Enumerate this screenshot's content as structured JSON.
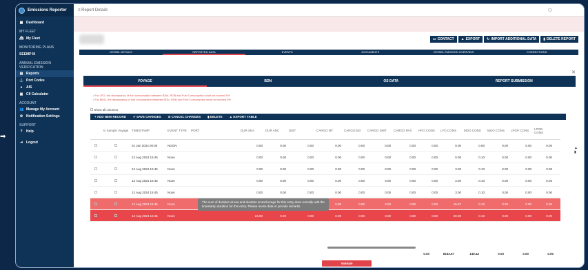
{
  "app": {
    "title": "Emissions Reporter"
  },
  "sidebar": {
    "dashboard": "Dashboard",
    "my_fleet_head": "MY FLEET",
    "my_fleet": "My Fleet",
    "monitoring_head": "MONITORING PLANS",
    "monitoring_item": "SEEMP III",
    "annual_head_1": "ANNUAL EMISSION",
    "annual_head_2": "VERIFICATION",
    "reports": "Reports",
    "port_codes": "Port Codes",
    "ais": "AIS",
    "cii_calculator": "CII Calculator",
    "account_head": "ACCOUNT",
    "manage_account": "Manage My Account",
    "notification_settings": "Notification Settings",
    "support_head": "SUPPORT",
    "help": "Help",
    "logout": "Logout"
  },
  "topbar": {
    "breadcrumb": "Report Details"
  },
  "actions": {
    "contact": "CONTACT",
    "export": "EXPORT",
    "import": "IMPORT ADDITIONAL DATA",
    "delete": "DELETE REPORT"
  },
  "tabs1": [
    "VESSEL DETAILS",
    "REPORTED DATA",
    "EVENTS",
    "DOCUMENTS",
    "VESSEL EMISSION OVERVIEW",
    "CORRECTIONS"
  ],
  "tabs2": [
    "VOYAGE",
    "BDN",
    "OS DATA",
    "REPORT SUBMISSION"
  ],
  "notes": [
    "• For LFO, the discrepancy of fuel consumption between BDN, ROB and Fuel Consumption shall not exceed 5%",
    "• For MDO, the discrepancy of fuel consumption between BDN, ROB and Fuel Consumption shall not exceed 5%"
  ],
  "show_all_columns": "Show all columns",
  "toolbar": {
    "add": "+ ADD NEW RECORD",
    "save": "SAVE CHANGES",
    "cancel": "CANCEL CHANGES",
    "delete": "DELETE",
    "export": "EXPORT TABLE"
  },
  "table": {
    "headers": [
      "Is Sample Voyage",
      "TIMESTAMP",
      "EVENT TYPE",
      "PORT",
      "DUR SEA",
      "DUR ANC",
      "DIST",
      "CARGO MT",
      "CARGO M3",
      "CARGO DWT",
      "CARGO PAX",
      "HFO CONS",
      "LFO CONS",
      "MDO CONS",
      "MGO CONS",
      "LPGP CONS",
      "LPGB CONS"
    ],
    "rows": [
      {
        "ts": "01 Jan 2024 00:00",
        "event": "NOON",
        "sea": "0.00",
        "anc": "0.00",
        "dist": "0.00",
        "v": [
          "0.00",
          "0.00",
          "0.00",
          "0.00",
          "0.00",
          "0.00",
          "0.00",
          "0.00",
          "0.00",
          "0.00"
        ]
      },
      {
        "ts": "12 Aug 2024 15:45",
        "event": "Noon",
        "sea": "0.00",
        "anc": "0.00",
        "dist": "0.00",
        "v": [
          "0.00",
          "0.00",
          "0.00",
          "0.00",
          "0.00",
          "0.00",
          "0.10",
          "0.00",
          "0.00",
          "0.00"
        ]
      },
      {
        "ts": "12 Aug 2024 15:45",
        "event": "Noon",
        "sea": "0.00",
        "anc": "0.00",
        "dist": "0.00",
        "v": [
          "0.00",
          "0.00",
          "0.00",
          "0.00",
          "0.00",
          "3.00",
          "0.10",
          "0.00",
          "0.00",
          "0.00"
        ]
      },
      {
        "ts": "12 Aug 2024 15:45",
        "event": "Noon",
        "sea": "0.00",
        "anc": "0.00",
        "dist": "0.00",
        "v": [
          "0.00",
          "0.00",
          "0.00",
          "0.00",
          "0.00",
          "3.00",
          "0.10",
          "0.00",
          "0.00",
          "0.00"
        ]
      },
      {
        "ts": "12 Aug 2024 15:45",
        "event": "Noon",
        "sea": "0.00",
        "anc": "0.00",
        "dist": "0.00",
        "v": [
          "0.00",
          "0.00",
          "0.00",
          "0.00",
          "0.00",
          "3.00",
          "0.10",
          "0.00",
          "0.00",
          "0.00"
        ]
      },
      {
        "ts": "12 Aug 2024 15:45",
        "event": "Noon",
        "sea": "18.00",
        "anc": "0.00",
        "dist": "0.00",
        "v": [
          "0.00",
          "0.00",
          "0.00",
          "0.00",
          "0.00",
          "15.87",
          "0.10",
          "0.00",
          "0.00",
          "0.00"
        ]
      },
      {
        "ts": "12 Aug 2024 15:45",
        "event": "Noon",
        "sea": "24.00",
        "anc": "0.00",
        "dist": "0.00",
        "v": [
          "0.00",
          "0.00",
          "0.00",
          "0.00",
          "0.00",
          "20.00",
          "0.10",
          "0.00",
          "0.00",
          "0.00"
        ]
      }
    ]
  },
  "tooltip": "The sum of duration at sea and duration at anchorage for this entry does not tally with the timestamp duration for this entry. Please revise data or provide remarks.",
  "totals": [
    "0.00",
    "8183.67",
    "149.42",
    "0.00",
    "0.00",
    "0.00"
  ],
  "validate": "Validate",
  "colors": {
    "navy": "#0f3357",
    "accent": "#e0434a",
    "error_row": "#f06b6b"
  }
}
